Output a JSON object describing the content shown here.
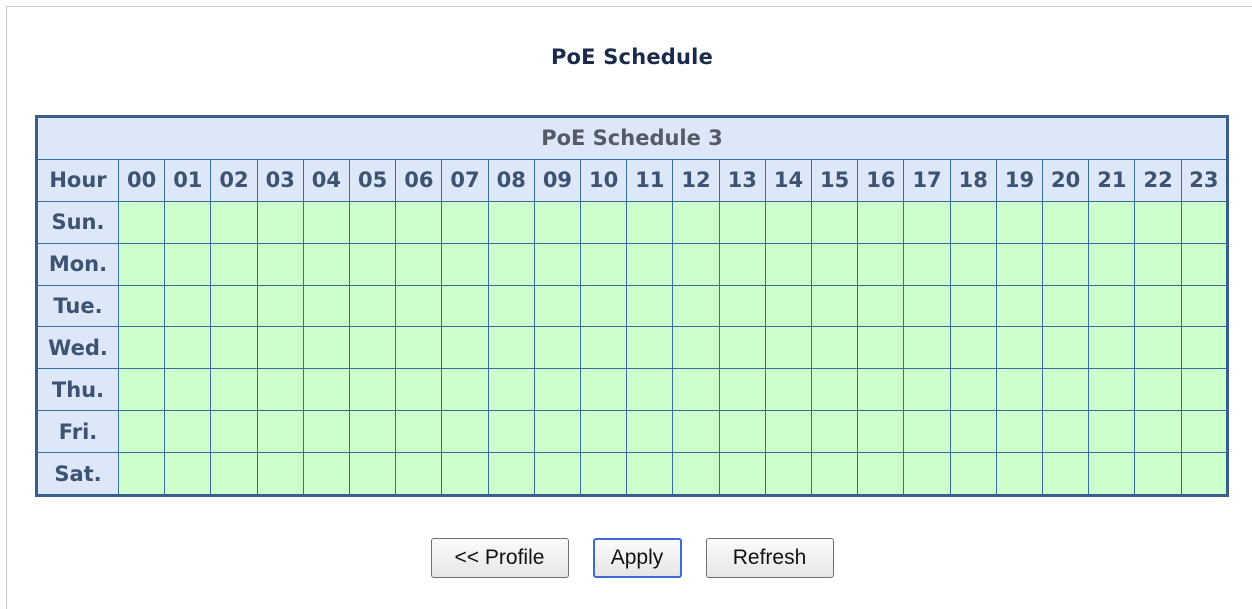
{
  "page": {
    "title": "PoE Schedule"
  },
  "schedule": {
    "title": "PoE Schedule 3",
    "hour_header": "Hour",
    "hours": [
      "00",
      "01",
      "02",
      "03",
      "04",
      "05",
      "06",
      "07",
      "08",
      "09",
      "10",
      "11",
      "12",
      "13",
      "14",
      "15",
      "16",
      "17",
      "18",
      "19",
      "20",
      "21",
      "22",
      "23"
    ],
    "days": [
      "Sun.",
      "Mon.",
      "Tue.",
      "Wed.",
      "Thu.",
      "Fri.",
      "Sat."
    ],
    "slot_color": "#ccffcc",
    "header_color": "#dce8f8",
    "border_color": "#3a6da0"
  },
  "buttons": {
    "profile_label": "<< Profile",
    "apply_label": "Apply",
    "refresh_label": "Refresh"
  }
}
